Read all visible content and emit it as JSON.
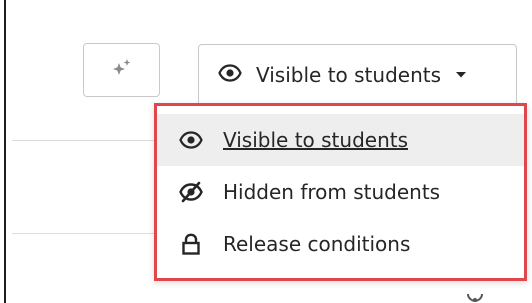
{
  "toolbar": {
    "magic_icon": "sparkle-icon",
    "visibility_button": {
      "label": "Visible to students",
      "icon": "eye-icon",
      "caret_icon": "caret-down-icon"
    }
  },
  "visibility_menu": {
    "items": [
      {
        "label": "Visible to students",
        "icon": "eye-icon",
        "selected": true
      },
      {
        "label": "Hidden from students",
        "icon": "eye-slash-icon",
        "selected": false
      },
      {
        "label": "Release conditions",
        "icon": "lock-icon",
        "selected": false
      }
    ]
  },
  "colors": {
    "highlight_border": "#e0474c",
    "text": "#262626",
    "selected_background": "#eeeeee",
    "border": "#c9c9c9"
  }
}
